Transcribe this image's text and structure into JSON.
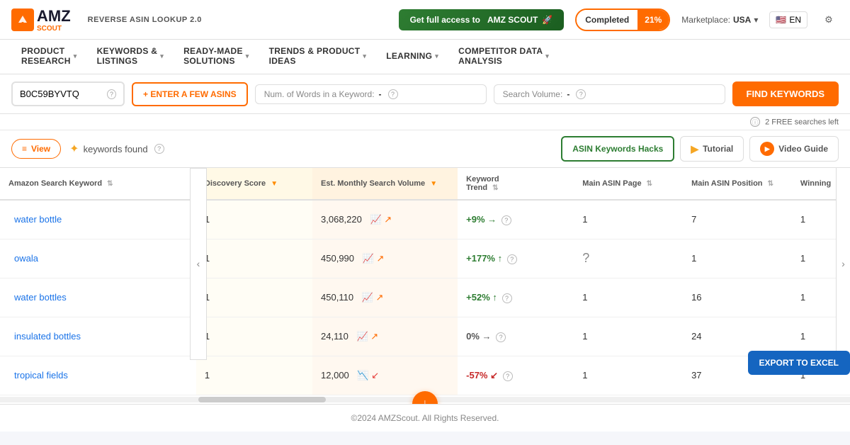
{
  "header": {
    "logo_text": "AMZ",
    "logo_sub": "SCOUT",
    "tool_label": "REVERSE ASIN LOOKUP 2.0",
    "get_access_label": "Get full access to",
    "get_access_brand": "AMZ SCOUT",
    "completed_label": "Completed",
    "completed_pct": "21%",
    "marketplace_label": "Marketplace:",
    "marketplace_value": "USA",
    "lang": "EN",
    "settings_icon": "⚙"
  },
  "nav": {
    "items": [
      {
        "label": "PRODUCT RESEARCH",
        "has_arrow": true
      },
      {
        "label": "KEYWORDS & LISTINGS",
        "has_arrow": true
      },
      {
        "label": "READY-MADE SOLUTIONS",
        "has_arrow": true
      },
      {
        "label": "TRENDS & PRODUCT IDEAS",
        "has_arrow": true
      },
      {
        "label": "LEARNING",
        "has_arrow": true
      },
      {
        "label": "COMPETITOR DATA ANALYSIS",
        "has_arrow": true
      }
    ]
  },
  "toolbar": {
    "asin_value": "B0C59BYVTQ",
    "enter_asins_label": "+ ENTER A FEW ASINS",
    "filter1_label": "Num. of Words in a Keyword:",
    "filter1_value": "-",
    "filter2_label": "Search Volume:",
    "filter2_value": "-",
    "find_btn_label": "FIND KEYWORDS"
  },
  "free_searches": {
    "text": "2 FREE searches left"
  },
  "results_bar": {
    "view_label": "View",
    "keywords_found": "keywords found",
    "hack_btn": "ASIN Keywords Hacks",
    "tutorial_btn": "Tutorial",
    "video_btn": "Video Guide"
  },
  "table": {
    "columns": [
      {
        "id": "keyword",
        "label": "Amazon Search Keyword"
      },
      {
        "id": "discovery",
        "label": "Discovery Score",
        "sorted": true,
        "sort_dir": "▼"
      },
      {
        "id": "search_vol",
        "label": "Est. Monthly Search Volume",
        "sorted": true,
        "sort_dir": "▼"
      },
      {
        "id": "trend",
        "label": "Keyword Trend"
      },
      {
        "id": "asin_page",
        "label": "Main ASIN Page"
      },
      {
        "id": "asin_pos",
        "label": "Main ASIN Position"
      },
      {
        "id": "winning",
        "label": "Winning"
      }
    ],
    "rows": [
      {
        "keyword": "water bottle",
        "discovery": "1",
        "search_vol": "3,068,220",
        "trend_val": "+9%",
        "trend_dir": "→",
        "trend_type": "up",
        "asin_page": "1",
        "asin_pos": "7",
        "winning": "1"
      },
      {
        "keyword": "owala",
        "discovery": "1",
        "search_vol": "450,990",
        "trend_val": "+177%",
        "trend_dir": "↑",
        "trend_type": "up",
        "asin_page": "",
        "asin_pos": "1",
        "winning": "1"
      },
      {
        "keyword": "water bottles",
        "discovery": "1",
        "search_vol": "450,110",
        "trend_val": "+52%",
        "trend_dir": "↑",
        "trend_type": "up",
        "asin_page": "1",
        "asin_pos": "16",
        "winning": "1"
      },
      {
        "keyword": "insulated bottles",
        "discovery": "1",
        "search_vol": "24,110",
        "trend_val": "0%",
        "trend_dir": "→",
        "trend_type": "neutral",
        "asin_page": "1",
        "asin_pos": "24",
        "winning": "1"
      },
      {
        "keyword": "tropical fields",
        "discovery": "1",
        "search_vol": "12,000",
        "trend_val": "-57%",
        "trend_dir": "↙",
        "trend_type": "down",
        "asin_page": "1",
        "asin_pos": "37",
        "winning": "1"
      }
    ]
  },
  "export_btn_label": "EXPORT TO EXCEL",
  "footer": {
    "text": "©2024 AMZScout. All Rights Reserved."
  }
}
